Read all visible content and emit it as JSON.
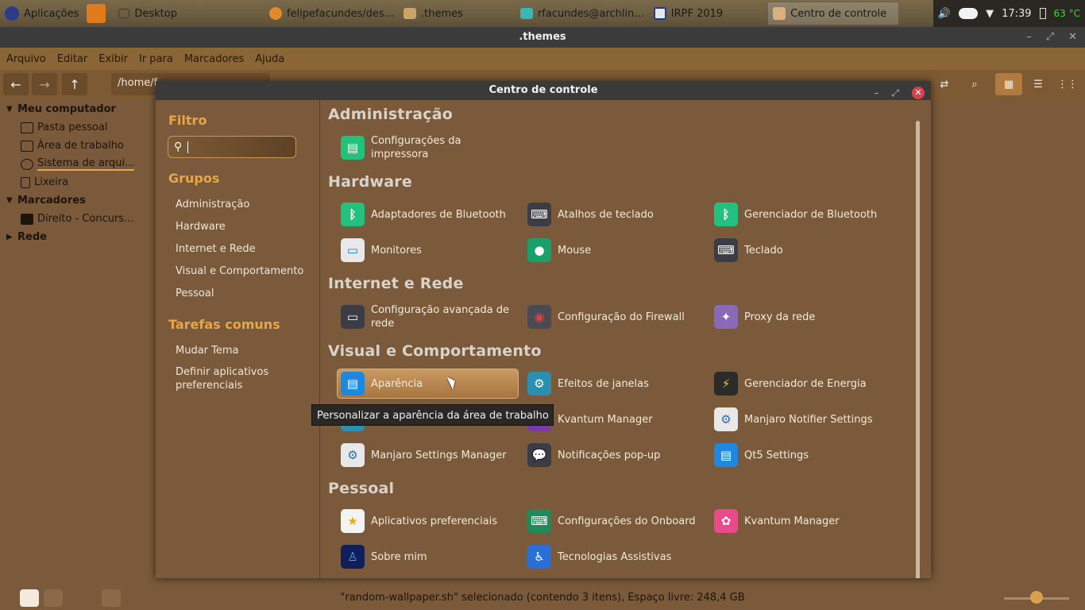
{
  "panel": {
    "apps_label": "Aplicações",
    "desktop_label": "Desktop",
    "tasks": [
      {
        "label": "felipefacundes/des..."
      },
      {
        "label": ".themes"
      },
      {
        "label": "rfacundes@archlin..."
      },
      {
        "label": "IRPF 2019"
      },
      {
        "label": "Centro de controle"
      }
    ],
    "clock": "17:39",
    "temperature": "63 °C"
  },
  "filemanager": {
    "title": ".themes",
    "menu": [
      "Arquivo",
      "Editar",
      "Exibir",
      "Ir para",
      "Marcadores",
      "Ajuda"
    ],
    "path": "/home/f",
    "sidebar": {
      "sections": [
        {
          "title": "Meu computador",
          "items": [
            "Pasta pessoal",
            "Área de trabalho",
            "Sistema de arqui...",
            "Lixeira"
          ]
        },
        {
          "title": "Marcadores",
          "items": [
            "Direito - Concurs..."
          ]
        },
        {
          "title": "Rede",
          "items": []
        }
      ]
    },
    "status": "\"random-wallpaper.sh\" selecionado (contendo 3 itens), Espaço livre: 248,4 GB"
  },
  "control_center": {
    "title": "Centro de controle",
    "left": {
      "filter_heading": "Filtro",
      "groups_heading": "Grupos",
      "groups": [
        "Administração",
        "Hardware",
        "Internet e Rede",
        "Visual e Comportamento",
        "Pessoal"
      ],
      "tasks_heading": "Tarefas comuns",
      "tasks": [
        "Mudar Tema",
        "Definir aplicativos preferenciais"
      ]
    },
    "sections": [
      {
        "title": "Administração",
        "items": [
          "Configurações da impressora"
        ]
      },
      {
        "title": "Hardware",
        "items": [
          "Adaptadores de Bluetooth",
          "Atalhos de teclado",
          "Gerenciador de Bluetooth",
          "Monitores",
          "Mouse",
          "Teclado"
        ]
      },
      {
        "title": "Internet e Rede",
        "items": [
          "Configuração avançada de rede",
          "Configuração do Firewall",
          "Proxy da rede"
        ]
      },
      {
        "title": "Visual e Comportamento",
        "items": [
          "Aparência",
          "Efeitos de janelas",
          "Gerenciador de Energia",
          "",
          "Kvantum Manager",
          "Manjaro Notifier Settings",
          "Manjaro Settings Manager",
          "Notificações pop-up",
          "Qt5 Settings"
        ]
      },
      {
        "title": "Pessoal",
        "items": [
          "Aplicativos preferenciais",
          "Configurações do Onboard",
          "Kvantum Manager",
          "Sobre mim",
          "Tecnologias Assistivas"
        ]
      }
    ],
    "tooltip": "Personalizar a aparência da área de trabalho"
  },
  "colors": {
    "accent": "#e6a64a",
    "close": "#d8414b"
  }
}
